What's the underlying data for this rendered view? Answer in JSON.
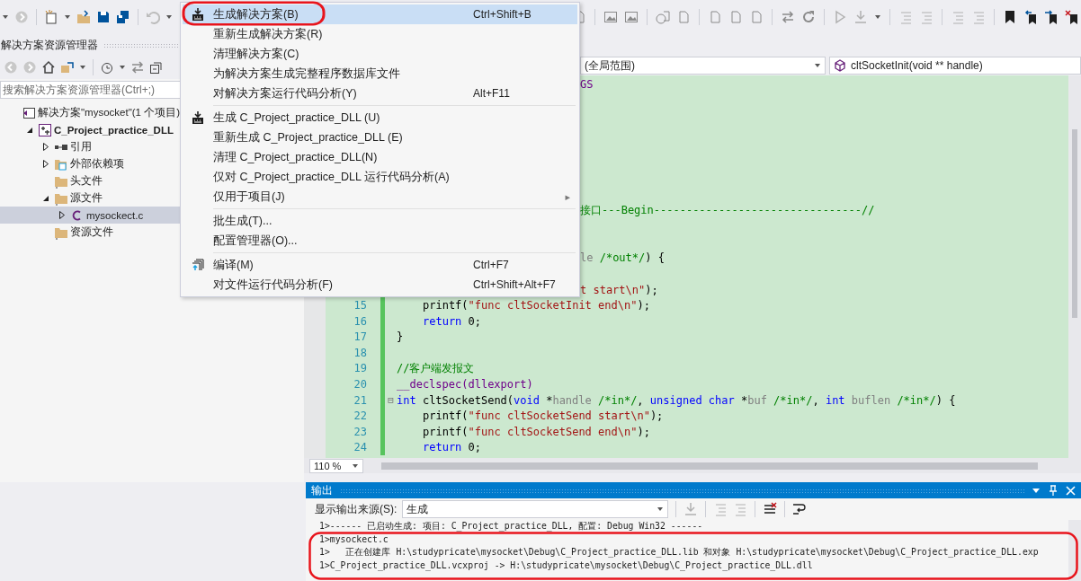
{
  "solution_explorer": {
    "title": "解决方案资源管理器",
    "search": {
      "placeholder": "搜索解决方案资源管理器(Ctrl+;)"
    },
    "tree": [
      {
        "label": "解决方案\"mysocket\"(1 个项目)",
        "kind": "solution",
        "selected": false,
        "children": [
          {
            "label": "C_Project_practice_DLL",
            "kind": "project",
            "expanded": true,
            "selected": false,
            "children": [
              {
                "label": "引用",
                "kind": "reference",
                "expanded": false,
                "selected": false
              },
              {
                "label": "外部依赖项",
                "kind": "dependency",
                "expanded": false,
                "selected": false
              },
              {
                "label": "头文件",
                "kind": "folder",
                "selected": false
              },
              {
                "label": "源文件",
                "kind": "folder",
                "expanded": true,
                "selected": false,
                "children": [
                  {
                    "label": "mysockect.c",
                    "kind": "c-file",
                    "expanded": false,
                    "selected": true
                  }
                ]
              },
              {
                "label": "资源文件",
                "kind": "folder",
                "selected": false
              }
            ]
          }
        ]
      }
    ]
  },
  "build_menu": [
    {
      "kind": "build",
      "label": "生成解决方案(B)",
      "shortcut": "Ctrl+Shift+B",
      "selected": true
    },
    {
      "kind": "plain",
      "label": "重新生成解决方案(R)",
      "selected": false
    },
    {
      "kind": "plain",
      "label": "清理解决方案(C)",
      "selected": false
    },
    {
      "kind": "plain",
      "label": "为解决方案生成完整程序数据库文件",
      "selected": false
    },
    {
      "kind": "plain",
      "label": "对解决方案运行代码分析(Y)",
      "shortcut": "Alt+F11",
      "selected": false
    },
    {
      "kind": "separator"
    },
    {
      "kind": "build",
      "label": "生成 C_Project_practice_DLL (U)",
      "selected": false
    },
    {
      "kind": "plain",
      "label": "重新生成 C_Project_practice_DLL (E)",
      "selected": false
    },
    {
      "kind": "plain",
      "label": "清理 C_Project_practice_DLL(N)",
      "selected": false
    },
    {
      "kind": "plain",
      "label": "仅对 C_Project_practice_DLL 运行代码分析(A)",
      "selected": false
    },
    {
      "kind": "submenu",
      "label": "仅用于项目(J)",
      "submenu_arrow": "▸",
      "selected": false
    },
    {
      "kind": "separator"
    },
    {
      "kind": "plain",
      "label": "批生成(T)...",
      "selected": false
    },
    {
      "kind": "plain",
      "label": "配置管理器(O)...",
      "selected": false
    },
    {
      "kind": "separator"
    },
    {
      "kind": "compile",
      "label": "编译(M)",
      "shortcut": "Ctrl+F7",
      "selected": false
    },
    {
      "kind": "plain",
      "label": "对文件运行代码分析(F)",
      "shortcut": "Ctrl+Shift+Alt+F7",
      "selected": false
    }
  ],
  "editor": {
    "scope": "(全局范围)",
    "member": "cltSocketInit(void ** handle)",
    "zoom": "110 %",
    "lines": [
      {
        "kind": "fragment",
        "tokens": [
          {
            "kind": "macro",
            "text": "GS"
          }
        ]
      },
      {
        "kind": "hidden"
      },
      {
        "kind": "hidden"
      },
      {
        "kind": "hidden"
      },
      {
        "kind": "hidden"
      },
      {
        "kind": "hidden"
      },
      {
        "kind": "hidden"
      },
      {
        "kind": "hidden"
      },
      {
        "kind": "fragment",
        "tokens": [
          {
            "kind": "comment",
            "text": "接口---Begin--------------------------------//"
          }
        ]
      },
      {
        "kind": "hidden"
      },
      {
        "kind": "hidden"
      },
      {
        "kind": "fragment",
        "tokens": [
          {
            "kind": "param",
            "text": "le "
          },
          {
            "kind": "comment",
            "text": "/*out*/"
          },
          {
            "kind": "plain",
            "text": ") {"
          }
        ]
      },
      {
        "kind": "hidden"
      },
      {
        "kind": "fragment",
        "tokens": [
          {
            "kind": "string",
            "text": "t start\\n\""
          },
          {
            "kind": "plain",
            "text": ");"
          }
        ]
      },
      {
        "kind": "code",
        "number": "15",
        "indent": true,
        "tokens": [
          {
            "kind": "plain",
            "text": "printf("
          },
          {
            "kind": "string",
            "text": "\"func cltSocketInit end\\n\""
          },
          {
            "kind": "plain",
            "text": ");"
          }
        ]
      },
      {
        "kind": "code",
        "number": "16",
        "indent": true,
        "tokens": [
          {
            "kind": "keyword",
            "text": "return"
          },
          {
            "kind": "plain",
            "text": " 0;"
          }
        ]
      },
      {
        "kind": "code",
        "number": "17",
        "indent": false,
        "tokens": [
          {
            "kind": "plain",
            "text": "}"
          }
        ]
      },
      {
        "kind": "code",
        "number": "18"
      },
      {
        "kind": "code",
        "number": "19",
        "indent": false,
        "tokens": [
          {
            "kind": "comment",
            "text": "//客户端发报文"
          }
        ]
      },
      {
        "kind": "code",
        "number": "20",
        "indent": false,
        "tokens": [
          {
            "kind": "macro",
            "text": "__declspec(dllexport)"
          }
        ]
      },
      {
        "kind": "code",
        "number": "21",
        "fold": "⊟",
        "indent": false,
        "tokens": [
          {
            "kind": "keyword",
            "text": "int"
          },
          {
            "kind": "plain",
            "text": " cltSocketSend("
          },
          {
            "kind": "keyword",
            "text": "void"
          },
          {
            "kind": "plain",
            "text": " *"
          },
          {
            "kind": "param",
            "text": "handle"
          },
          {
            "kind": "comment",
            "text": " /*in*/"
          },
          {
            "kind": "plain",
            "text": ", "
          },
          {
            "kind": "keyword",
            "text": "unsigned char"
          },
          {
            "kind": "plain",
            "text": " *"
          },
          {
            "kind": "param",
            "text": "buf"
          },
          {
            "kind": "comment",
            "text": " /*in*/"
          },
          {
            "kind": "plain",
            "text": ", "
          },
          {
            "kind": "keyword",
            "text": "int"
          },
          {
            "kind": "param",
            "text": " buflen"
          },
          {
            "kind": "comment",
            "text": " /*in*/"
          },
          {
            "kind": "plain",
            "text": ") {"
          }
        ]
      },
      {
        "kind": "code",
        "number": "22",
        "indent": true,
        "tokens": [
          {
            "kind": "plain",
            "text": "printf("
          },
          {
            "kind": "string",
            "text": "\"func cltSocketSend start\\n\""
          },
          {
            "kind": "plain",
            "text": ");"
          }
        ]
      },
      {
        "kind": "code",
        "number": "23",
        "indent": true,
        "tokens": [
          {
            "kind": "plain",
            "text": "printf("
          },
          {
            "kind": "string",
            "text": "\"func cltSocketSend end\\n\""
          },
          {
            "kind": "plain",
            "text": ");"
          }
        ]
      },
      {
        "kind": "code",
        "number": "24",
        "indent": true,
        "tokens": [
          {
            "kind": "keyword",
            "text": "return"
          },
          {
            "kind": "plain",
            "text": " 0;"
          }
        ]
      }
    ]
  },
  "output": {
    "title": "输出",
    "source_label": "显示输出来源(S):",
    "source": "生成",
    "lines": [
      "1>------ 已启动生成: 项目: C_Project_practice_DLL, 配置: Debug Win32 ------",
      "1>mysockect.c",
      "1>   正在创建库 H:\\studypricate\\mysocket\\Debug\\C_Project_practice_DLL.lib 和对象 H:\\studypricate\\mysocket\\Debug\\C_Project_practice_DLL.exp",
      "1>C_Project_practice_DLL.vcxproj -> H:\\studypricate\\mysocket\\Debug\\C_Project_practice_DLL.dll"
    ]
  }
}
